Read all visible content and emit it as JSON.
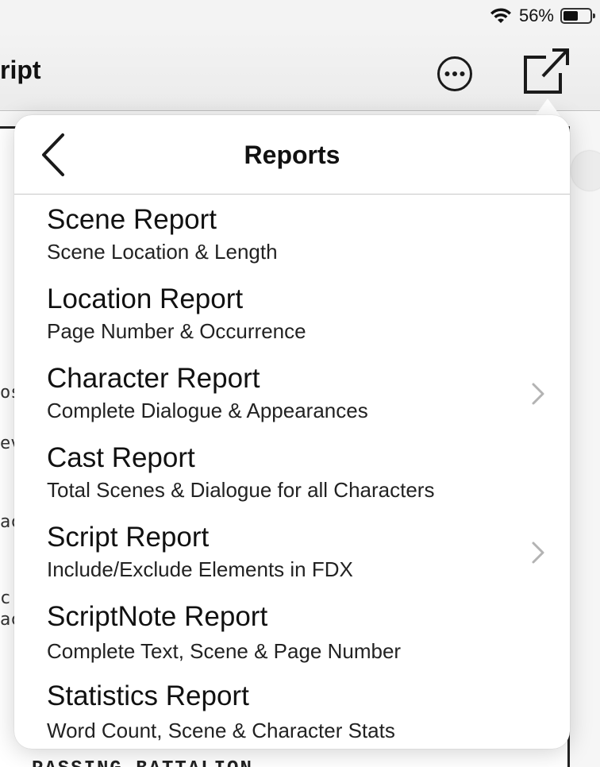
{
  "status_bar": {
    "battery_percent": "56%",
    "battery_level": 0.56
  },
  "nav": {
    "title_fragment": "ript"
  },
  "document": {
    "snippets": [
      "os",
      "ev",
      "ac",
      "c",
      "ac"
    ],
    "footer_fragment": "PASSING BATTALION"
  },
  "popover": {
    "title": "Reports",
    "items": [
      {
        "title": "Scene Report",
        "subtitle": "Scene Location & Length"
      },
      {
        "title": "Location Report",
        "subtitle": "Page Number & Occurrence"
      },
      {
        "title": "Character Report",
        "subtitle": "Complete Dialogue & Appearances"
      },
      {
        "title": "Cast Report",
        "subtitle": "Total Scenes & Dialogue for all Characters"
      },
      {
        "title": "Script Report",
        "subtitle": "Include/Exclude Elements in FDX"
      },
      {
        "title": "ScriptNote Report",
        "subtitle": "Complete Text, Scene & Page Number"
      },
      {
        "title": "Statistics Report",
        "subtitle": "Word Count, Scene & Character Stats"
      }
    ]
  }
}
